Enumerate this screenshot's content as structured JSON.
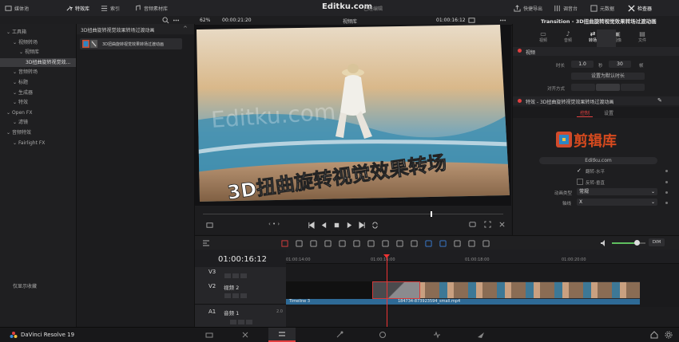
{
  "topbar": {
    "items": [
      {
        "label": "媒体池",
        "icon": "media-pool-icon"
      },
      {
        "label": "特效库",
        "icon": "effects-icon",
        "active": true
      },
      {
        "label": "索引",
        "icon": "index-icon"
      },
      {
        "label": "音频素材库",
        "icon": "sound-library-icon"
      }
    ],
    "title": "Editku.com",
    "subtitle": "已经编辑",
    "right_items": [
      {
        "label": "快捷导出",
        "icon": "export-icon"
      },
      {
        "label": "调音台",
        "icon": "mixer-icon"
      },
      {
        "label": "元数据",
        "icon": "metadata-icon"
      },
      {
        "label": "检查器",
        "icon": "inspector-icon"
      }
    ]
  },
  "viewer_bar": {
    "zoom": "62%",
    "timecode_left": "00:00:21:20",
    "source": "视频库",
    "timecode_right": "01:00:16:12"
  },
  "media_tree": {
    "items": [
      {
        "label": "工具箱",
        "indent": 0
      },
      {
        "label": "视频转场",
        "indent": 1
      },
      {
        "label": "视频库",
        "indent": 2
      },
      {
        "label": "3D扭曲旋转视觉效...",
        "indent": 3,
        "selected": true
      },
      {
        "label": "音频转场",
        "indent": 1
      },
      {
        "label": "标题",
        "indent": 1
      },
      {
        "label": "生成器",
        "indent": 1
      },
      {
        "label": "特效",
        "indent": 1
      },
      {
        "label": "Open FX",
        "indent": 0
      },
      {
        "label": "滤镜",
        "indent": 1
      },
      {
        "label": "音频特效",
        "indent": 0
      },
      {
        "label": "Fairlight FX",
        "indent": 1
      }
    ],
    "footer": "仅显示收藏"
  },
  "effects_list": {
    "header": "3D扭曲旋转视觉效果转场过渡动画",
    "items": [
      {
        "label": "3D扭曲旋转视觉效果转场过渡动画"
      }
    ]
  },
  "viewer": {
    "watermark": "Editku.com",
    "caption_line1": "3D扭曲旋转视觉效果转场"
  },
  "inspector": {
    "title": "Transition - 3D扭曲旋转视觉效果转场过渡动画",
    "tabs": [
      "视频",
      "音频",
      "转场",
      "图像",
      "文件"
    ],
    "video_section": "视频",
    "duration_label": "时长",
    "duration_value": "1.0",
    "seconds_label": "秒",
    "frames_value": "30",
    "frames_label": "帧",
    "reset_button": "设置为默认时长",
    "alignment_label": "对齐方式",
    "effect_section": "特效 - 3D扭曲旋转视觉效果转场过渡动画",
    "sub_tabs": [
      "控制",
      "设置"
    ],
    "logo_text": "剪辑库",
    "url_text": "Editku.com",
    "flip_h": "翻转-水平",
    "flip_v": "反转-垂直",
    "anim_type_label": "动画类型",
    "anim_type_value": "常规",
    "axis_label": "轴线",
    "axis_value": "X"
  },
  "timeline": {
    "timecode": "01:00:16:12",
    "ruler": [
      "01:00:14:00",
      "01:00:16:00",
      "01:00:18:00",
      "01:00:20:00"
    ],
    "tracks": [
      {
        "id": "V3",
        "name": ""
      },
      {
        "id": "V2",
        "name": "视频 2"
      },
      {
        "id": "A1",
        "name": "音频 1",
        "level": "2.0"
      }
    ],
    "clip_v2_left": "Timeline 3",
    "clip_v2_right": "184734-873923594_small.mp4",
    "dim_label": "DIM"
  },
  "bottombar": {
    "app_name": "DaVinci Resolve 19"
  },
  "colors": {
    "accent_red": "#e24040",
    "clip_blue": "#2e6a96",
    "panel_bg": "#1e1e20"
  }
}
